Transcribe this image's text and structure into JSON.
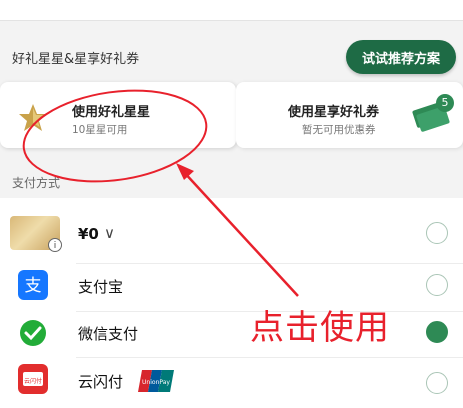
{
  "header": {
    "section_title": "好礼星星&星享好礼券",
    "suggest_button": "试试推荐方案"
  },
  "cards": {
    "stars": {
      "title": "使用好礼星星",
      "subtitle": "10星星可用",
      "icon": "star-icon"
    },
    "coupon": {
      "title": "使用星享好礼券",
      "subtitle": "暂无可用优惠券",
      "badge": "5",
      "icon": "coupon-icon"
    }
  },
  "payment": {
    "section_label": "支付方式",
    "methods": [
      {
        "label": "¥0",
        "icon": "gift-card-icon",
        "selected": false
      },
      {
        "label": "支付宝",
        "icon": "alipay-icon",
        "selected": false
      },
      {
        "label": "微信支付",
        "icon": "wechat-pay-icon",
        "selected": true
      },
      {
        "label": "云闪付",
        "icon": "cloudpay-icon",
        "selected": false
      }
    ],
    "info_icon_text": "i",
    "chevron": "∨",
    "alipay_glyph": "支",
    "cloudpay_icon_text": "云闪付",
    "unionpay_text": "UnionPay"
  },
  "annotation": {
    "text": "点击使用",
    "color": "#e8212c"
  },
  "colors": {
    "accent": "#1e6b45",
    "selected": "#2e8a55"
  }
}
